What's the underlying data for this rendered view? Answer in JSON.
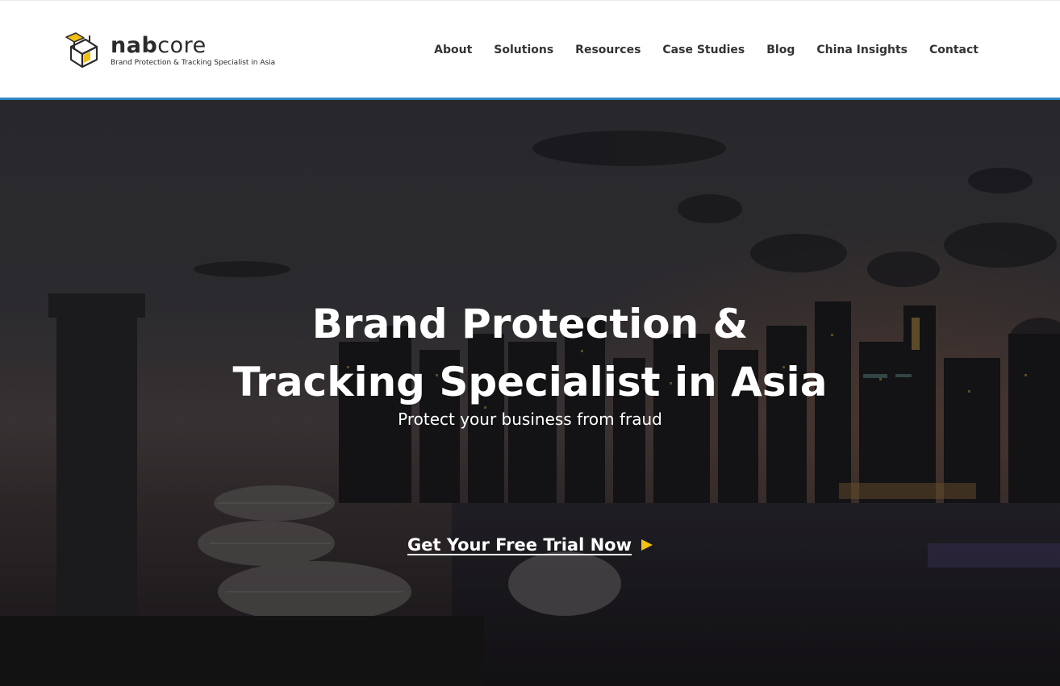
{
  "brand": {
    "name_bold": "nab",
    "name_light": "core",
    "tagline": "Brand Protection & Tracking Specialist in Asia",
    "logo_icon": "nabcore-cube-logo-icon",
    "accent_color": "#f2c014",
    "rule_color": "#2f86c8"
  },
  "nav": {
    "items": [
      {
        "label": "About"
      },
      {
        "label": "Solutions"
      },
      {
        "label": "Resources"
      },
      {
        "label": "Case Studies"
      },
      {
        "label": "Blog"
      },
      {
        "label": "China Insights"
      },
      {
        "label": "Contact"
      }
    ]
  },
  "hero": {
    "title_line1": "Brand Protection &",
    "title_line2": "Tracking Specialist in Asia",
    "subtitle": "Protect your business from fraud",
    "cta_label": "Get Your Free Trial Now",
    "cta_icon": "play-arrow-icon",
    "background": "night-city-skyline-photo"
  }
}
